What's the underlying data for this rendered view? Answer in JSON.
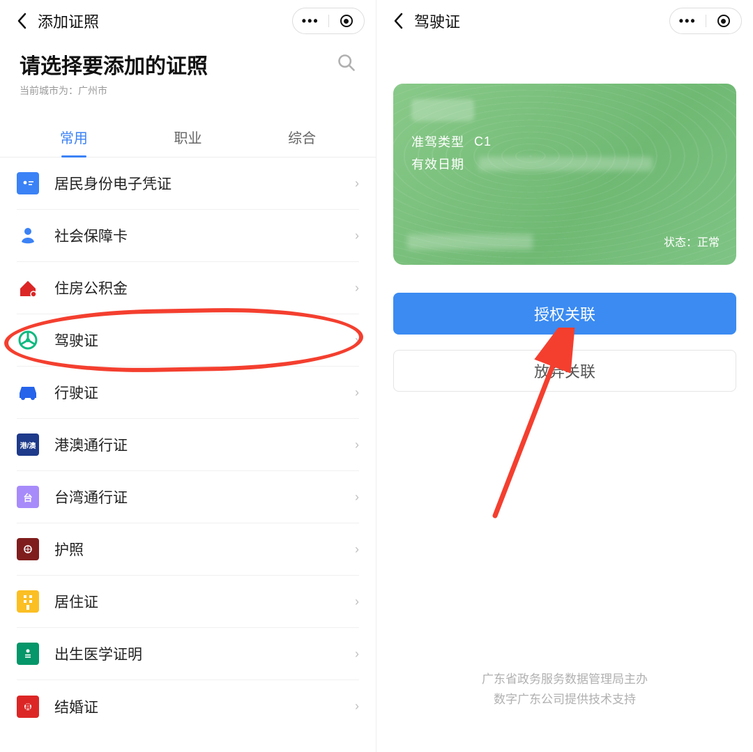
{
  "left": {
    "topbar_title": "添加证照",
    "page_title": "请选择要添加的证照",
    "city_prefix": "当前城市为：",
    "city_name": "广州市",
    "tabs": [
      "常用",
      "职业",
      "综合"
    ],
    "active_tab_index": 0,
    "items": [
      {
        "label": "居民身份电子凭证",
        "icon": "id-card-icon"
      },
      {
        "label": "社会保障卡",
        "icon": "social-security-icon"
      },
      {
        "label": "住房公积金",
        "icon": "house-fund-icon"
      },
      {
        "label": "驾驶证",
        "icon": "drive-license-icon",
        "highlighted": true
      },
      {
        "label": "行驶证",
        "icon": "vehicle-license-icon"
      },
      {
        "label": "港澳通行证",
        "icon": "hkmo-permit-icon"
      },
      {
        "label": "台湾通行证",
        "icon": "taiwan-permit-icon"
      },
      {
        "label": "护照",
        "icon": "passport-icon"
      },
      {
        "label": "居住证",
        "icon": "residence-permit-icon"
      },
      {
        "label": "出生医学证明",
        "icon": "birth-cert-icon"
      },
      {
        "label": "结婚证",
        "icon": "marriage-cert-icon"
      }
    ]
  },
  "right": {
    "topbar_title": "驾驶证",
    "card": {
      "drive_type_label": "准驾类型",
      "drive_type_value": "C1",
      "valid_label": "有效日期",
      "status_label": "状态：",
      "status_value": "正常"
    },
    "primary_btn": "授权关联",
    "secondary_btn": "放弃关联",
    "footer_line1": "广东省政务服务数据管理局主办",
    "footer_line2": "数字广东公司提供技术支持"
  },
  "icons": {
    "hkmo_text": "港/澳",
    "tw_text": "台"
  }
}
